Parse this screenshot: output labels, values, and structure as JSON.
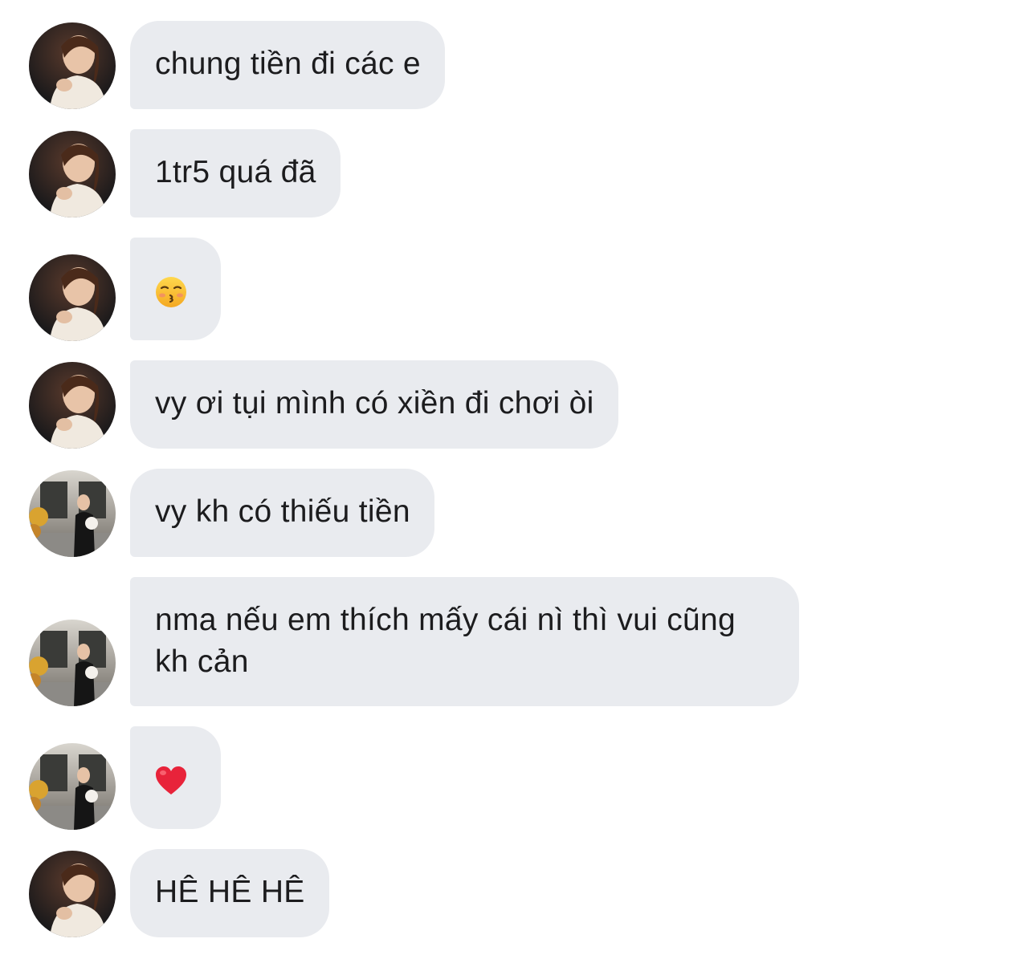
{
  "conversation": {
    "messages": [
      {
        "sender": "contact-a",
        "text": "chung tiền đi các e"
      },
      {
        "sender": "contact-a",
        "text": "1tr5 quá đã"
      },
      {
        "sender": "contact-a",
        "emoji": "kissing-face-icon"
      },
      {
        "sender": "contact-a",
        "text": "vy ơi tụi mình có xiền đi chơi òi"
      },
      {
        "sender": "contact-b",
        "text": "vy kh có thiếu tiền"
      },
      {
        "sender": "contact-b",
        "text": "nma nếu em thích mấy cái nì thì vui cũng kh cản"
      },
      {
        "sender": "contact-b",
        "emoji": "red-heart-icon"
      },
      {
        "sender": "contact-a",
        "text": "HÊ HÊ HÊ"
      }
    ]
  },
  "colors": {
    "bubble_background": "#e9ebef",
    "text": "#1c1c1e",
    "heart": "#e8233a",
    "emoji_face": "#f7bd2f"
  }
}
